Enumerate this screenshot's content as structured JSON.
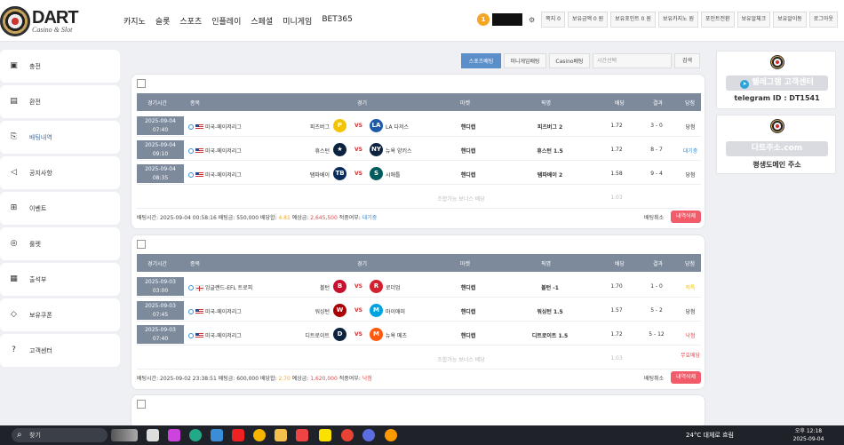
{
  "header": {
    "logo": {
      "title": "DART",
      "subtitle": "Casino & Slot"
    },
    "nav": [
      "카지노",
      "슬롯",
      "스포츠",
      "인플레이",
      "스페셜",
      "미니게임",
      "BET365"
    ],
    "user_level": "1",
    "top_buttons": [
      "쪽지 0",
      "보유금액 0 원",
      "보유포인트 0 원",
      "보유카지노 원",
      "포인트전환",
      "보유알체크",
      "보유알이동",
      "로그아웃"
    ]
  },
  "sidebar": [
    {
      "label": "충전",
      "icon": "wallet-icon"
    },
    {
      "label": "환전",
      "icon": "cash-icon"
    },
    {
      "label": "배팅내역",
      "icon": "history-icon",
      "active": true
    },
    {
      "label": "공지사항",
      "icon": "megaphone-icon"
    },
    {
      "label": "이벤트",
      "icon": "gift-icon"
    },
    {
      "label": "룰렛",
      "icon": "roulette-icon"
    },
    {
      "label": "출석부",
      "icon": "calendar-icon"
    },
    {
      "label": "보유쿠폰",
      "icon": "coupon-icon"
    },
    {
      "label": "고객센터",
      "icon": "help-icon"
    }
  ],
  "toolbar": {
    "tabs": [
      "스포츠배팅",
      "미니게임배팅",
      "Casino배팅"
    ],
    "search_placeholder": "시간선택",
    "search_button": "검색"
  },
  "table_headers": [
    "경기시간",
    "종목",
    "경기",
    "마켓",
    "픽명",
    "배당",
    "결과",
    "당첨"
  ],
  "bets": [
    {
      "rows": [
        {
          "date": "2025-09-04",
          "time": "07:40",
          "league": "미국-메이저리그",
          "flag": "us",
          "home": "피츠버그",
          "home_color": "#f5c400",
          "home_glyph": "P",
          "away": "LA 다저스",
          "away_color": "#1e5aa8",
          "away_glyph": "LA",
          "market": "핸디캡",
          "pick": "피츠버그 2",
          "odds": "1.72",
          "result": "3 - 0",
          "status": "당첨",
          "status_color": "#333"
        },
        {
          "date": "2025-09-04",
          "time": "09:10",
          "league": "미국-메이저리그",
          "flag": "us",
          "home": "휴스턴",
          "home_color": "#0c2340",
          "home_glyph": "★",
          "away": "뉴욕 양키스",
          "away_color": "#0c2340",
          "away_glyph": "NY",
          "market": "핸디캡",
          "pick": "휴스턴 1.5",
          "odds": "1.72",
          "result": "8 - 7",
          "status": "대기중",
          "status_color": "#3a8ed8"
        },
        {
          "date": "2025-09-04",
          "time": "08:35",
          "league": "미국-메이저리그",
          "flag": "us",
          "home": "탬파베이",
          "home_color": "#092c5c",
          "home_glyph": "TB",
          "away": "시애틀",
          "away_color": "#005c5c",
          "away_glyph": "S",
          "market": "핸디캡",
          "pick": "탬파베이 2",
          "odds": "1.58",
          "result": "9 - 4",
          "status": "당첨",
          "status_color": "#333"
        }
      ],
      "bonus_label": "조합가능 보너스 배당",
      "bonus_odds": "1.03",
      "bonus_status": "",
      "bet_time": "2025-09-04 00:58:16",
      "bet_amount": "550,000",
      "total_odds": "4.81",
      "expected": "2,645,500",
      "applied": "대기중",
      "applied_class": "blue",
      "cancel_label": "배팅취소",
      "delete_label": "내역삭제"
    },
    {
      "rows": [
        {
          "date": "2025-09-03",
          "time": "03:00",
          "league": "잉글랜드-EFL 트로피",
          "flag": "en",
          "home": "볼턴",
          "home_color": "#c8102e",
          "home_glyph": "B",
          "away": "로더엄",
          "away_color": "#d2202f",
          "away_glyph": "R",
          "market": "핸디캡",
          "pick": "볼턴 -1",
          "odds": "1.70",
          "result": "1 - 0",
          "status": "적특",
          "status_color": "#f5c400"
        },
        {
          "date": "2025-09-03",
          "time": "07:45",
          "league": "미국-메이저리그",
          "flag": "us",
          "home": "워싱턴",
          "home_color": "#ab0003",
          "home_glyph": "W",
          "away": "마이애미",
          "away_color": "#00a3e0",
          "away_glyph": "M",
          "market": "핸디캡",
          "pick": "워싱턴 1.5",
          "odds": "1.57",
          "result": "5 - 2",
          "status": "당첨",
          "status_color": "#333"
        },
        {
          "date": "2025-09-03",
          "time": "07:40",
          "league": "미국-메이저리그",
          "flag": "us",
          "home": "디트로이트",
          "home_color": "#0c2340",
          "home_glyph": "D",
          "away": "뉴욕 메츠",
          "away_color": "#ff5910",
          "away_glyph": "M",
          "market": "핸디캡",
          "pick": "디트로이트 1.5",
          "odds": "1.72",
          "result": "5 - 12",
          "status": "낙첨",
          "status_color": "#e44"
        }
      ],
      "bonus_label": "조합가능 보너스 배당",
      "bonus_odds": "1.03",
      "bonus_status": "무효배당",
      "bet_time": "2025-09-02 23:38:51",
      "bet_amount": "600,000",
      "total_odds": "2.70",
      "expected": "1,620,000",
      "applied": "낙첨",
      "applied_class": "red",
      "cancel_label": "배팅취소",
      "delete_label": "내역삭제"
    }
  ],
  "footer_labels": {
    "bet_time": "배팅시간:",
    "bet_amount": "배팅금:",
    "total_odds": "배당합:",
    "expected": "예상금:",
    "applied": "적중여부:"
  },
  "banners": {
    "telegram": {
      "title": "텔레그램 고객센터",
      "id": "telegram ID : DT1541"
    },
    "domain": {
      "title": "다트주소.com",
      "sub": "평생도메인 주소"
    }
  },
  "taskbar": {
    "search": "찾기",
    "weather": "24°C 대체로 흐림",
    "time": "오후 12:18",
    "date": "2025-09-04"
  }
}
